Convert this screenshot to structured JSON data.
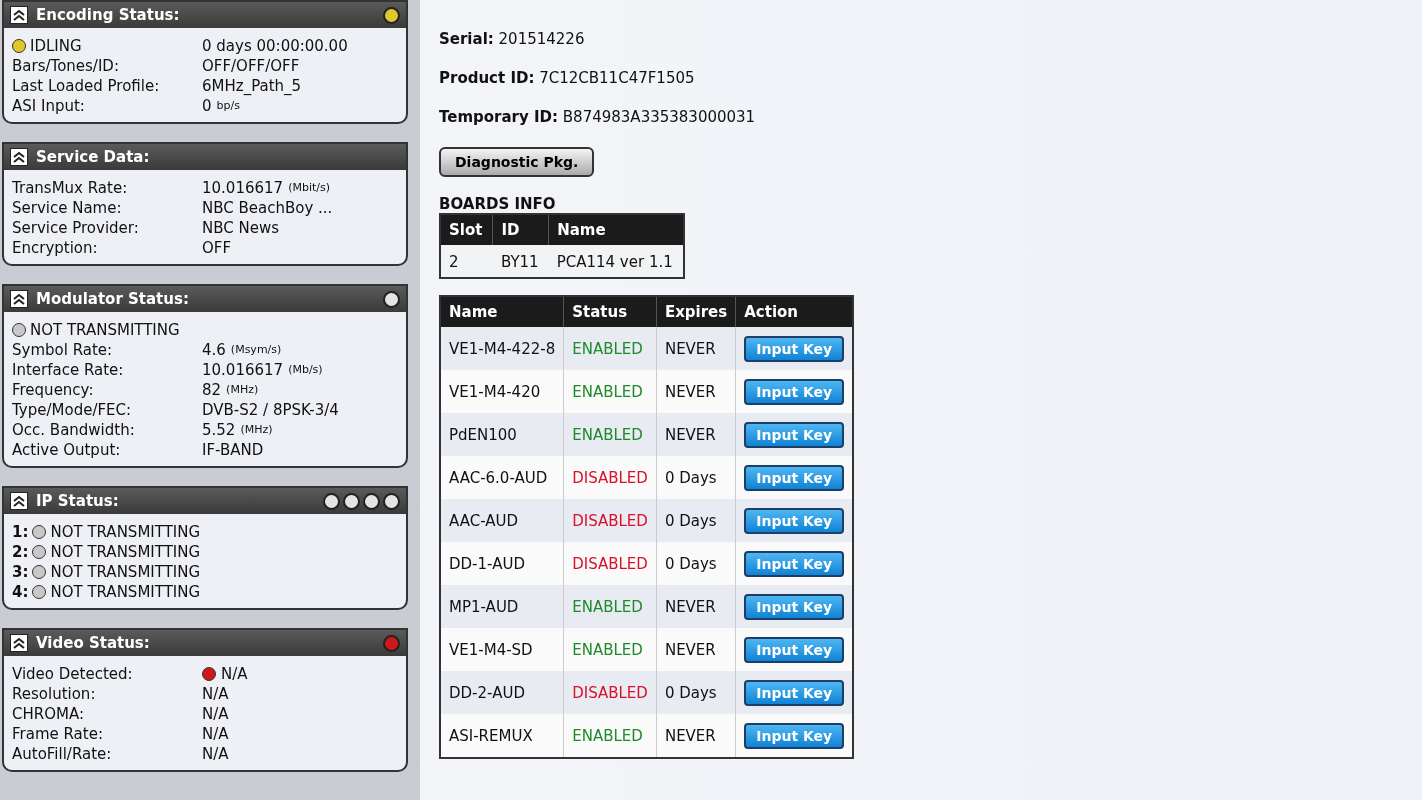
{
  "panels": [
    {
      "title": "Encoding Status:",
      "lamps": [
        {
          "color": "#e2c62a"
        }
      ],
      "rows": [
        {
          "kind": "status",
          "color": "#e2c62a",
          "label": "IDLING",
          "value": "0 days 00:00:00.00"
        },
        {
          "kind": "field",
          "label": "Bars/Tones/ID:",
          "value": "OFF/OFF/OFF"
        },
        {
          "kind": "field",
          "label": "Last Loaded Profile:",
          "value": "6MHz_Path_5"
        },
        {
          "kind": "field",
          "label": "ASI Input:",
          "value": "0",
          "unit": "bp/s"
        }
      ]
    },
    {
      "title": "Service Data:",
      "rows": [
        {
          "kind": "field",
          "label": "TransMux Rate:",
          "value": "10.016617",
          "unit": "(Mbit/s)"
        },
        {
          "kind": "field",
          "label": "Service Name:",
          "value": "NBC BeachBoy ..."
        },
        {
          "kind": "field",
          "label": "Service Provider:",
          "value": "NBC News"
        },
        {
          "kind": "field",
          "label": "Encryption:",
          "value": "OFF"
        }
      ]
    },
    {
      "title": "Modulator Status:",
      "lamps": [
        {
          "color": "#e4e4e4"
        }
      ],
      "rows": [
        {
          "kind": "status",
          "color": "#c8c8c8",
          "label": "NOT TRANSMITTING"
        },
        {
          "kind": "field",
          "label": "Symbol Rate:",
          "value": "4.6",
          "unit": "(Msym/s)"
        },
        {
          "kind": "field",
          "label": "Interface Rate:",
          "value": "10.016617",
          "unit": "(Mb/s)"
        },
        {
          "kind": "field",
          "label": "Frequency:",
          "value": "82",
          "unit": "(MHz)"
        },
        {
          "kind": "field",
          "label": "Type/Mode/FEC:",
          "value": "DVB-S2 / 8PSK-3/4"
        },
        {
          "kind": "field",
          "label": "Occ. Bandwidth:",
          "value": "5.52",
          "unit": "(MHz)"
        },
        {
          "kind": "field",
          "label": "Active Output:",
          "value": "IF-BAND"
        }
      ]
    },
    {
      "title": "IP Status:",
      "lamps": [
        {
          "color": "#e4e4e4"
        },
        {
          "color": "#e4e4e4"
        },
        {
          "color": "#e4e4e4"
        },
        {
          "color": "#e4e4e4"
        }
      ],
      "rows": [
        {
          "kind": "numbered",
          "number": "1:",
          "color": "#c8c8c8",
          "label": "NOT TRANSMITTING"
        },
        {
          "kind": "numbered",
          "number": "2:",
          "color": "#c8c8c8",
          "label": "NOT TRANSMITTING"
        },
        {
          "kind": "numbered",
          "number": "3:",
          "color": "#c8c8c8",
          "label": "NOT TRANSMITTING"
        },
        {
          "kind": "numbered",
          "number": "4:",
          "color": "#c8c8c8",
          "label": "NOT TRANSMITTING"
        }
      ]
    },
    {
      "title": "Video Status:",
      "lamps": [
        {
          "color": "#d01818"
        }
      ],
      "rows": [
        {
          "kind": "field",
          "label": "Video Detected:",
          "color": "#d01818",
          "value": "N/A"
        },
        {
          "kind": "field",
          "label": "Resolution:",
          "value": "N/A"
        },
        {
          "kind": "field",
          "label": "CHROMA:",
          "value": "N/A"
        },
        {
          "kind": "field",
          "label": "Frame Rate:",
          "value": "N/A"
        },
        {
          "kind": "field",
          "label": "AutoFill/Rate:",
          "value": "N/A"
        }
      ]
    }
  ],
  "info": [
    {
      "label": "Serial:",
      "value": "201514226"
    },
    {
      "label": "Product ID:",
      "value": "7C12CB11C47F1505"
    },
    {
      "label": "Temporary ID:",
      "value": "B874983A335383000031"
    }
  ],
  "diagnostic_button": "Diagnostic Pkg.",
  "boards": {
    "title": "BOARDS INFO",
    "columns": [
      "Slot",
      "ID",
      "Name"
    ],
    "rows": [
      [
        "2",
        "BY11",
        "PCA114 ver 1.1"
      ]
    ]
  },
  "licenses": {
    "columns": [
      "Name",
      "Status",
      "Expires",
      "Action"
    ],
    "rows": [
      {
        "name": "VE1-M4-422-8",
        "status": "ENABLED",
        "enabled": true,
        "expires": "NEVER",
        "action": "Input Key"
      },
      {
        "name": "VE1-M4-420",
        "status": "ENABLED",
        "enabled": true,
        "expires": "NEVER",
        "action": "Input Key"
      },
      {
        "name": "PdEN100",
        "status": "ENABLED",
        "enabled": true,
        "expires": "NEVER",
        "action": "Input Key"
      },
      {
        "name": "AAC-6.0-AUD",
        "status": "DISABLED",
        "enabled": false,
        "expires": "0 Days",
        "action": "Input Key"
      },
      {
        "name": "AAC-AUD",
        "status": "DISABLED",
        "enabled": false,
        "expires": "0 Days",
        "action": "Input Key"
      },
      {
        "name": "DD-1-AUD",
        "status": "DISABLED",
        "enabled": false,
        "expires": "0 Days",
        "action": "Input Key"
      },
      {
        "name": "MP1-AUD",
        "status": "ENABLED",
        "enabled": true,
        "expires": "NEVER",
        "action": "Input Key"
      },
      {
        "name": "VE1-M4-SD",
        "status": "ENABLED",
        "enabled": true,
        "expires": "NEVER",
        "action": "Input Key"
      },
      {
        "name": "DD-2-AUD",
        "status": "DISABLED",
        "enabled": false,
        "expires": "0 Days",
        "action": "Input Key"
      },
      {
        "name": "ASI-REMUX",
        "status": "ENABLED",
        "enabled": true,
        "expires": "NEVER",
        "action": "Input Key"
      }
    ]
  }
}
